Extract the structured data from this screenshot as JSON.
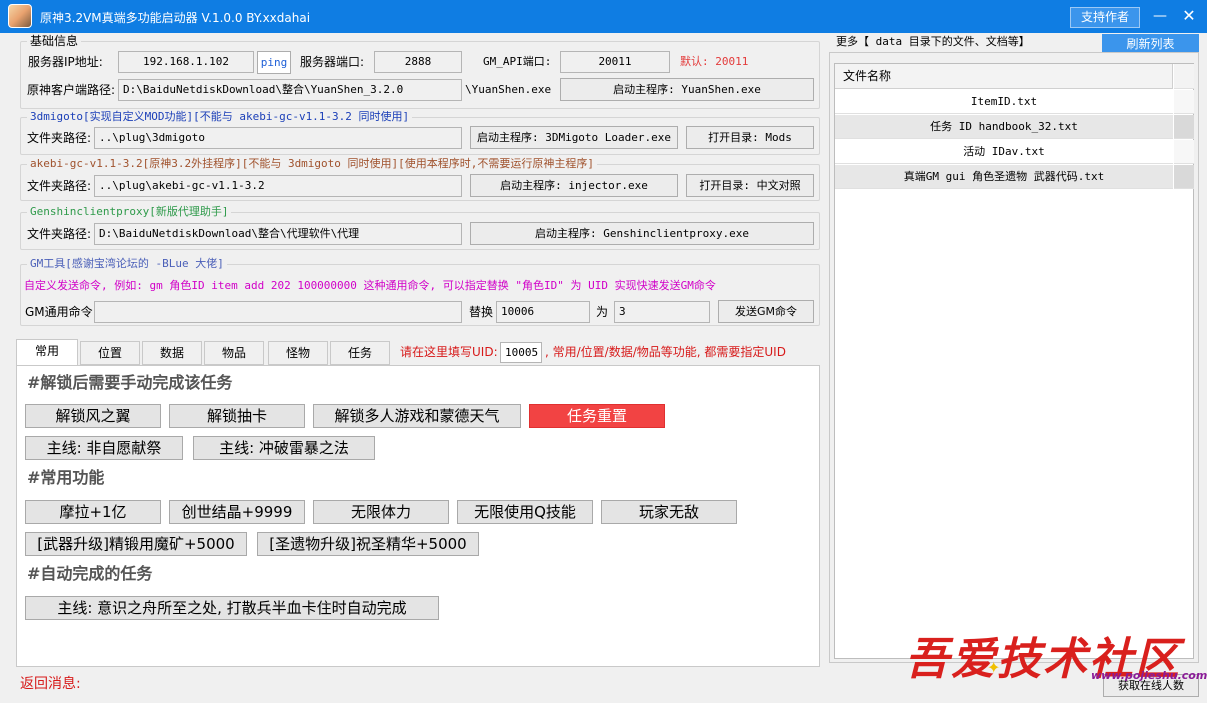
{
  "window": {
    "title": "原神3.2VM真端多功能启动器  V.1.0.0  BY.xxdahai",
    "support_label": "支持作者",
    "minimize_glyph": "—",
    "close_glyph": "✕"
  },
  "basic": {
    "group_title": "基础信息",
    "ip_label": "服务器IP地址:",
    "ip_value": "192.168.1.102",
    "ping_label": "ping",
    "port_label": "服务器端口:",
    "port_value": "2888",
    "gmapi_label": "GM_API端口:",
    "gmapi_value": "20011",
    "default_note": "默认: 20011",
    "client_path_label": "原神客户端路径:",
    "client_path_value": "D:\\BaiduNetdiskDownload\\整合\\YuanShen_3.2.0",
    "exe_suffix": "\\YuanShen.exe",
    "launch_label": "启动主程序: YuanShen.exe"
  },
  "migoto": {
    "group_title": "3dmigoto[实现自定义MOD功能][不能与 akebi-gc-v1.1-3.2 同时使用]",
    "folder_label": "文件夹路径:",
    "folder_value": "..\\plug\\3dmigoto",
    "launch_label": "启动主程序: 3DMigoto Loader.exe",
    "open_label": "打开目录: Mods"
  },
  "akebi": {
    "group_title": "akebi-gc-v1.1-3.2[原神3.2外挂程序][不能与 3dmigoto 同时使用][使用本程序时,不需要运行原神主程序]",
    "folder_label": "文件夹路径:",
    "folder_value": "..\\plug\\akebi-gc-v1.1-3.2",
    "launch_label": "启动主程序: injector.exe",
    "open_label": "打开目录: 中文对照"
  },
  "proxy": {
    "group_title": "Genshinclientproxy[新版代理助手]",
    "folder_label": "文件夹路径:",
    "folder_value": "D:\\BaiduNetdiskDownload\\整合\\代理软件\\代理",
    "launch_label": "启动主程序: Genshinclientproxy.exe"
  },
  "gm": {
    "group_title": "GM工具[感谢宝湾论坛的 -BLue 大佬]",
    "hint": "自定义发送命令, 例如: gm 角色ID item add 202 100000000 这种通用命令, 可以指定替换 \"角色ID\" 为 UID 实现快速发送GM命令",
    "cmd_label": "GM通用命令:",
    "cmd_value": "",
    "replace_label": "替换",
    "replace_value": "10006",
    "with_label": "为",
    "with_value": "3",
    "send_label": "发送GM命令"
  },
  "tabs": [
    {
      "label": "常用",
      "active": true
    },
    {
      "label": "位置",
      "active": false
    },
    {
      "label": "数据",
      "active": false
    },
    {
      "label": "物品",
      "active": false
    },
    {
      "label": "怪物",
      "active": false
    },
    {
      "label": "任务",
      "active": false
    }
  ],
  "uid": {
    "label": "请在这里填写UID:",
    "value": "10005",
    "note": ", 常用/位置/数据/物品等功能, 都需要指定UID"
  },
  "common": {
    "section1": "#解锁后需要手动完成该任务",
    "unlock_wings": "解锁风之翼",
    "unlock_gacha": "解锁抽卡",
    "unlock_multi": "解锁多人游戏和蒙德天气",
    "reset_quest": "任务重置",
    "main_nonvol": "主线: 非自愿献祭",
    "main_storm": "主线: 冲破雷暴之法",
    "section2": "#常用功能",
    "mora": "摩拉+1亿",
    "crystal": "创世结晶+9999",
    "stamina": "无限体力",
    "q_skill": "无限使用Q技能",
    "invincible": "玩家无敌",
    "weapon_ore": "[武器升级]精锻用魔矿+5000",
    "artifact_essence": "[圣遗物升级]祝圣精华+5000",
    "section3": "#自动完成的任务",
    "main_auto": "主线: 意识之舟所至之处, 打散兵半血卡住时自动完成"
  },
  "files": {
    "group_title": "更多【 data 目录下的文件、文档等】",
    "refresh_label": "刷新列表",
    "column_header": "文件名称",
    "rows": [
      "ItemID.txt",
      "任务 ID  handbook_32.txt",
      "活动 IDav.txt",
      "真端GM gui 角色圣遗物 武器代码.txt"
    ]
  },
  "status": {
    "return_label": "返回消息:",
    "online_label": "获取在线人数"
  },
  "watermark": {
    "text": "吾爱技术社区",
    "url": "www.pojieshu.com"
  },
  "colors": {
    "titlebar": "#0f7de3",
    "accent_blue": "#3b95ec",
    "danger": "#f24343",
    "hint_magenta": "#d100c8"
  }
}
